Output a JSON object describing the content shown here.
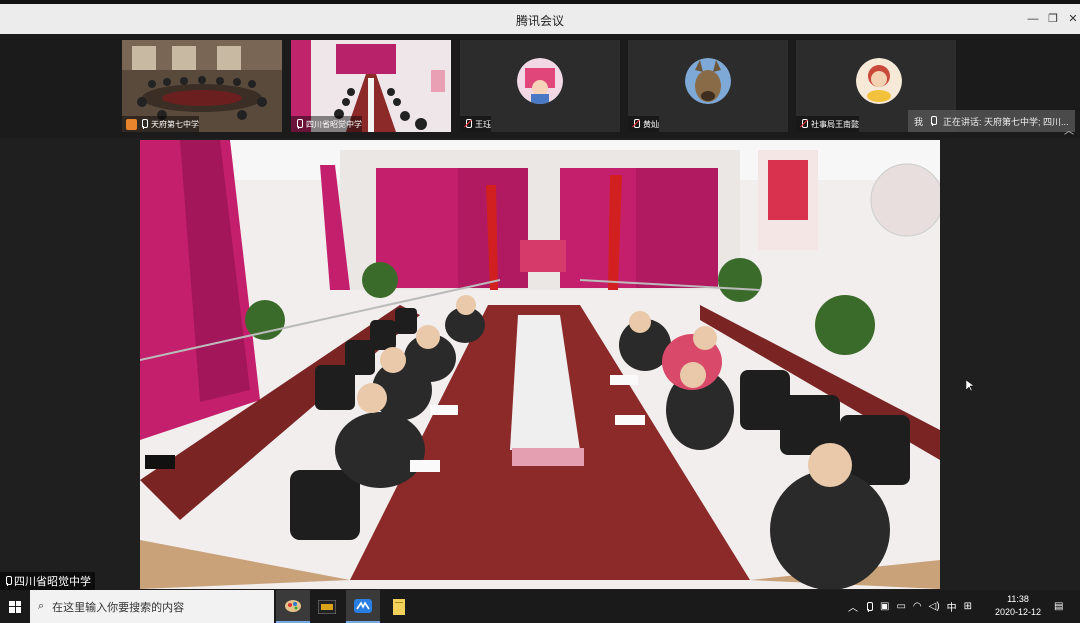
{
  "window": {
    "title": "腾讯会议"
  },
  "participants": [
    {
      "name": "天府第七中学",
      "type": "video"
    },
    {
      "name": "四川省昭觉中学",
      "type": "video"
    },
    {
      "name": "王珏",
      "type": "avatar"
    },
    {
      "name": "黄灿",
      "type": "avatar"
    },
    {
      "name": "社事局王南懿",
      "type": "avatar"
    }
  ],
  "speaking": {
    "me": "我",
    "text": "正在讲话: 天府第七中学; 四川..."
  },
  "main_video": {
    "presenter": "四川省昭觉中学"
  },
  "taskbar": {
    "search_placeholder": "在这里输入你要搜索的内容",
    "ime": "中",
    "time": "11:38",
    "date": "2020-12-12"
  },
  "colors": {
    "accent": "#77a9e3",
    "curtain": "#c0246a",
    "table": "#8c2a2a"
  }
}
